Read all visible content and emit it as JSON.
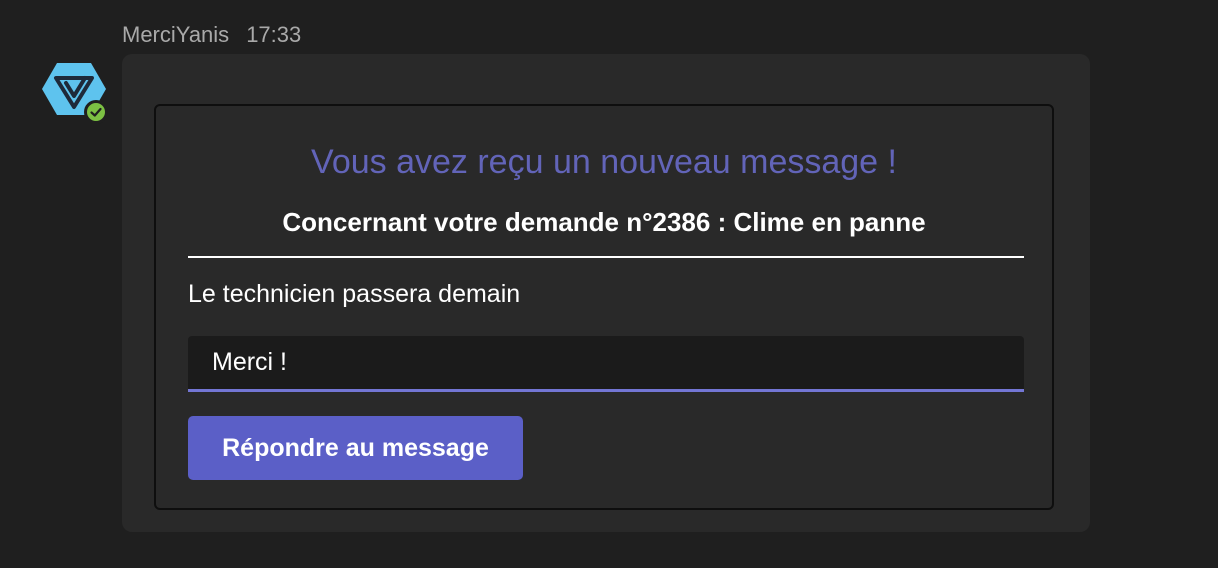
{
  "message": {
    "sender": "MerciYanis",
    "time": "17:33"
  },
  "avatar": {
    "icon": "merciyanis-logo-icon",
    "status_icon": "check-badge-icon",
    "colors": {
      "hexagon": "#5ec3ee",
      "check": "#7cc043"
    }
  },
  "card": {
    "title": "Vous avez reçu un nouveau message !",
    "subtitle": "Concernant votre demande n°2386 : Clime en panne",
    "body": "Le technicien passera demain",
    "reply_value": "Merci !",
    "button_label": "Répondre au message"
  },
  "colors": {
    "accent": "#5b5fc7",
    "title": "#6264b8",
    "background": "#1f1f1f",
    "bubble": "#292929"
  }
}
